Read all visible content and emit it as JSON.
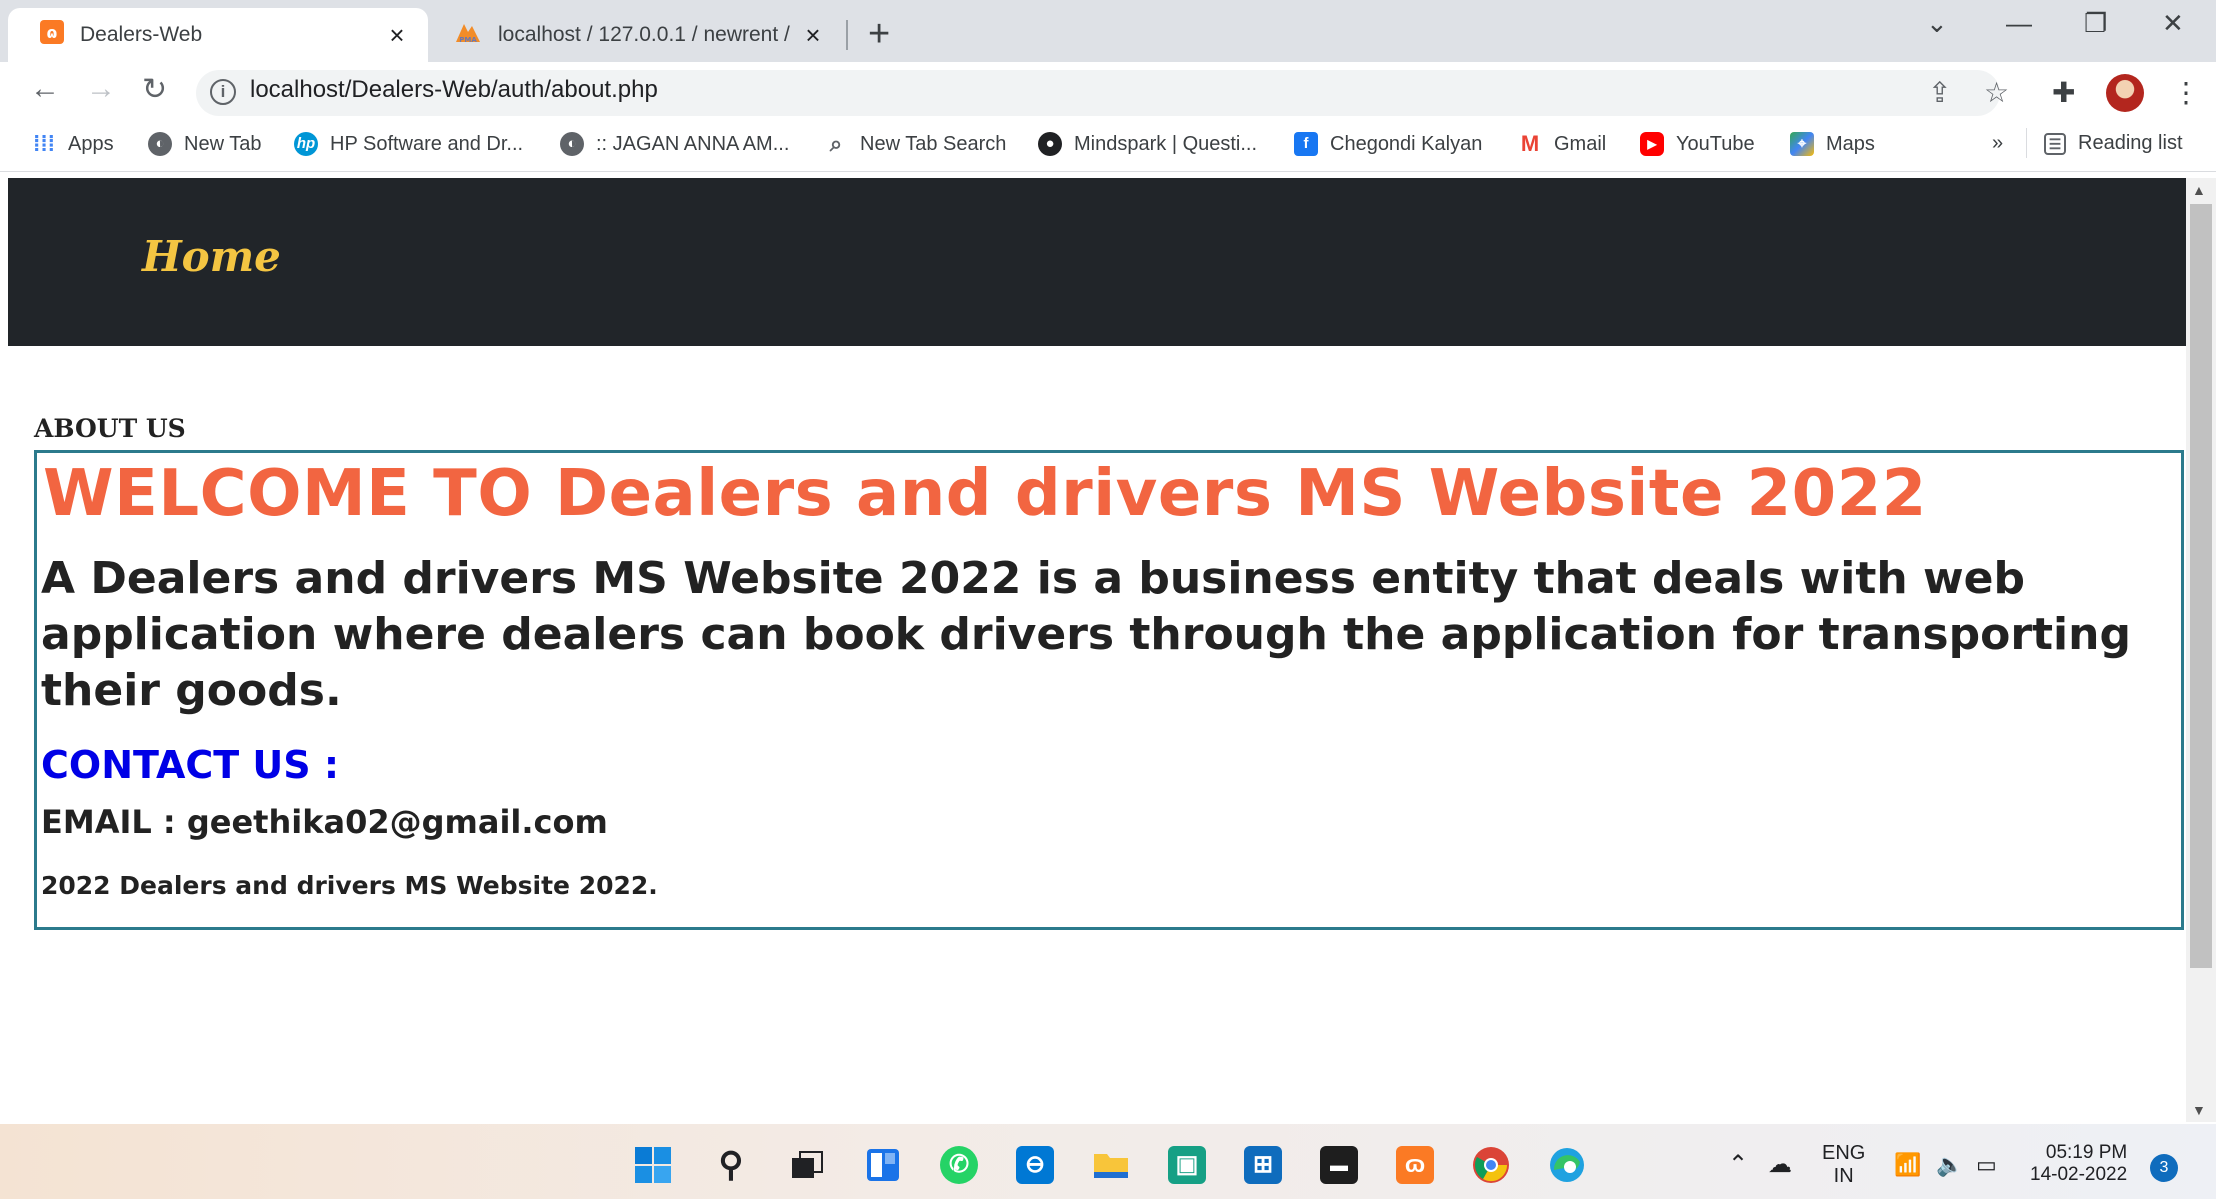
{
  "browser": {
    "tabs": [
      {
        "title": "Dealers-Web",
        "favicon": "xampp-icon",
        "close": "×"
      },
      {
        "title": "localhost / 127.0.0.1 / newrent / ",
        "favicon": "phpmyadmin-icon",
        "close": "×"
      }
    ],
    "new_tab": "+",
    "url": "localhost/Dealers-Web/auth/about.php",
    "bookmarks": [
      {
        "label": "Apps"
      },
      {
        "label": "New Tab"
      },
      {
        "label": "HP Software and Dr..."
      },
      {
        "label": ":: JAGAN ANNA AM..."
      },
      {
        "label": "New Tab Search"
      },
      {
        "label": "Mindspark | Questi..."
      },
      {
        "label": "Chegondi Kalyan"
      },
      {
        "label": "Gmail"
      },
      {
        "label": "YouTube"
      },
      {
        "label": "Maps"
      }
    ],
    "bookmarks_overflow": "»",
    "reading_list": "Reading list"
  },
  "page": {
    "nav_home": "Home",
    "about_heading": "ABOUT US",
    "welcome": "WELCOME TO Dealers and drivers MS Website 2022",
    "description": "A Dealers and drivers MS Website 2022 is a business entity that deals with web application where dealers can book drivers through the application for transporting their goods.",
    "contact_heading": "CONTACT US :",
    "email": "EMAIL : geethika02@gmail.com",
    "footer": "2022 Dealers and drivers MS Website 2022."
  },
  "taskbar": {
    "language": "ENG",
    "region": "IN",
    "time": "05:19 PM",
    "date": "14-02-2022",
    "notifications": "3"
  },
  "colors": {
    "navbar": "#212529",
    "home_link": "#f4c542",
    "welcome": "#f26541",
    "contact": "#0000e6",
    "box_border": "#2b7a8c"
  }
}
